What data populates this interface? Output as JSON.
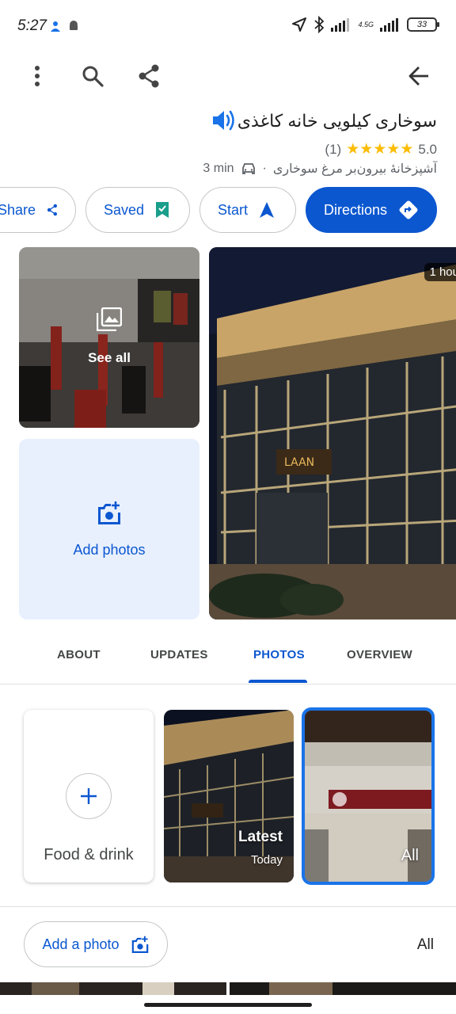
{
  "status_bar": {
    "time": "5:27",
    "network_label": "4.5G",
    "battery": "33"
  },
  "place": {
    "name": "سوخاری کیلویی خانه کاغذی",
    "rating": "5.0",
    "stars": "★★★★★",
    "review_count": "(1)",
    "category": "آشپزخانهٔ بیرون‌بر مرغ سوخاری",
    "separator": "·",
    "drive_time": "3 min"
  },
  "actions": {
    "share": "Share",
    "saved": "Saved",
    "start": "Start",
    "directions": "Directions"
  },
  "photos": {
    "see_all": "See all",
    "add_photos": "Add photos",
    "time_badge": "1 hou"
  },
  "tabs": [
    "ABOUT",
    "UPDATES",
    "PHOTOS",
    "OVERVIEW"
  ],
  "active_tab": "PHOTOS",
  "categories": {
    "food": "Food & drink",
    "latest": "Latest",
    "latest_sub": "Today",
    "all": "All"
  },
  "footer": {
    "add_photo": "Add a photo",
    "filter": "All"
  },
  "colors": {
    "accent": "#0b57d0",
    "star": "#fbbc04",
    "selected_border": "#1a73e8"
  }
}
